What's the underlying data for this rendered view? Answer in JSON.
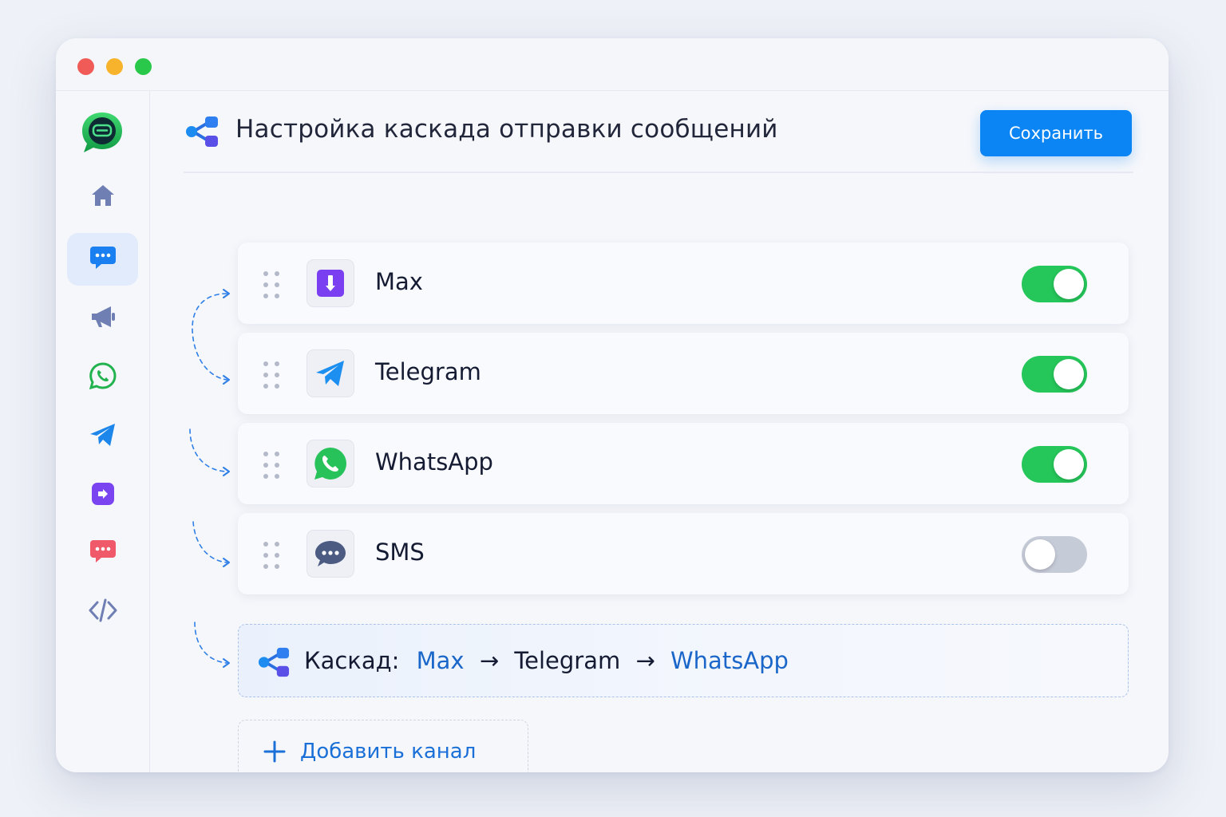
{
  "header": {
    "title": "Настройка каскада отправки сообщений",
    "save_label": "Сохранить"
  },
  "sidebar": {
    "logo_icon": "chat-bubble-logo-icon",
    "items": [
      {
        "icon": "home-icon",
        "active": false
      },
      {
        "icon": "chat-dots-icon",
        "active": true
      },
      {
        "icon": "megaphone-icon",
        "active": false
      },
      {
        "icon": "whatsapp-icon",
        "active": false
      },
      {
        "icon": "telegram-icon",
        "active": false
      },
      {
        "icon": "max-icon",
        "active": false
      },
      {
        "icon": "sms-bubble-icon",
        "active": false
      },
      {
        "icon": "code-icon",
        "active": false
      }
    ]
  },
  "channels": [
    {
      "name": "Max",
      "icon": "max-icon",
      "enabled": true
    },
    {
      "name": "Telegram",
      "icon": "telegram-icon",
      "enabled": true
    },
    {
      "name": "WhatsApp",
      "icon": "whatsapp-icon",
      "enabled": true
    },
    {
      "name": "SMS",
      "icon": "sms-icon",
      "enabled": false
    }
  ],
  "cascade": {
    "label": "Каскад:",
    "steps": [
      "Max",
      "Telegram",
      "WhatsApp"
    ],
    "arrow": "→"
  },
  "add_channel": {
    "label": "Добавить канал"
  },
  "colors": {
    "accent": "#0b84f4",
    "toggle_on": "#25c65a",
    "toggle_off": "#c6cbd8",
    "cascade_highlight": "#1b67c9"
  }
}
